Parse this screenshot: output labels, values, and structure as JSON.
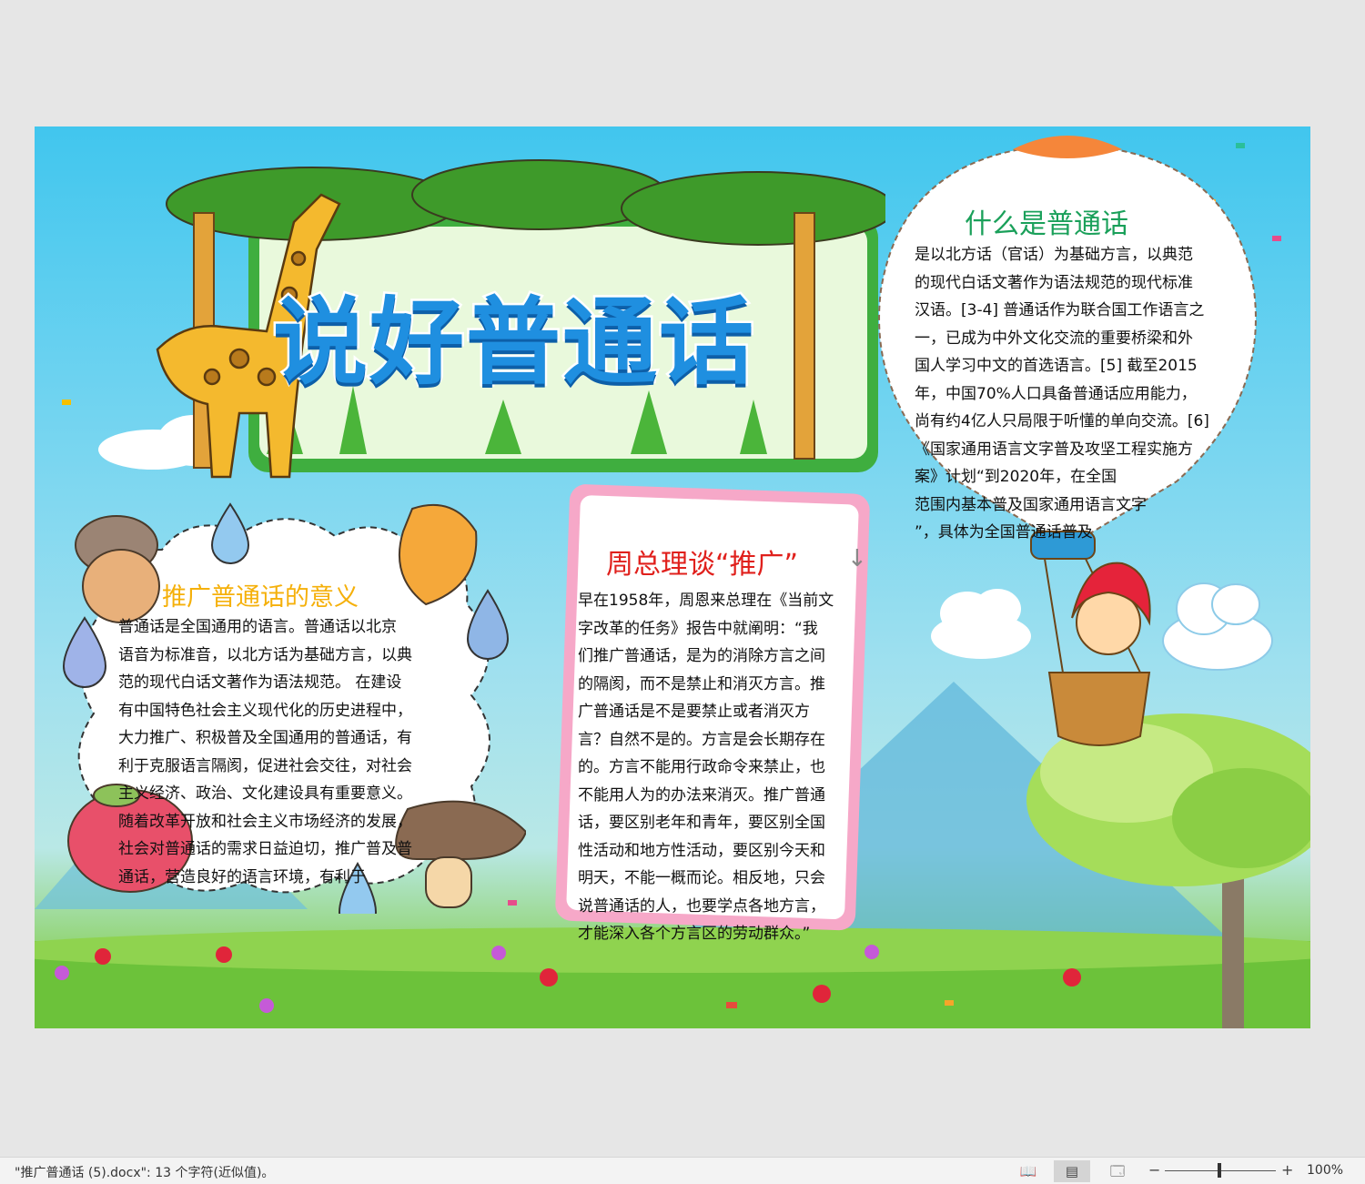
{
  "poster": {
    "title": "说好普通话",
    "section1": {
      "heading": "推广普通话的意义",
      "lines": [
        "普通话是全国通用的语言。普通话以北京",
        "语音为标准音，以北方话为基础方言，以典",
        "范的现代白话文著作为语法规范。 在建设",
        "有中国特色社会主义现代化的历史进程中，",
        "大力推广、积极普及全国通用的普通话，有",
        "利于克服语言隔阂，促进社会交往，对社会",
        "主义经济、政治、文化建设具有重要意义。",
        "随着改革开放和社会主义市场经济的发展，",
        "社会对普通话的需求日益迫切，推广普及普",
        "通话，营造良好的语言环境，有利于"
      ]
    },
    "section2": {
      "heading": "周总理谈“推广”",
      "lines": [
        "早在1958年，周恩来总理在《当前文",
        "字改革的任务》报告中就阐明：“我",
        "们推广普通话，是为的消除方言之间",
        "的隔阂，而不是禁止和消灭方言。推",
        "广普通话是不是要禁止或者消灭方",
        "言？自然不是的。方言是会长期存在",
        "的。方言不能用行政命令来禁止，也",
        "不能用人为的办法来消灭。推广普通",
        "话，要区别老年和青年，要区别全国",
        "性活动和地方性活动，要区别今天和",
        "明天，不能一概而论。相反地，只会",
        "说普通话的人，也要学点各地方言，",
        "才能深入各个方言区的劳动群众。”"
      ]
    },
    "section3": {
      "heading": "什么是普通话",
      "lines": [
        "是以北方话（官话）为基础方言，以典范",
        "的现代白话文著作为语法规范的现代标准",
        "汉语。[3-4]  普通话作为联合国工作语言之",
        "一，已成为中外文化交流的重要桥梁和外",
        "国人学习中文的首选语言。[5]  截至2015",
        "年，中国70%人口具备普通话应用能力，",
        "尚有约4亿人只局限于听懂的单向交流。[6]",
        "《国家通用语言文字普及攻坚工程实施方",
        "案》计划“到2020年，在全国",
        "范围内基本普及国家通用语言文字",
        "”，具体为全国普通话普及"
      ]
    }
  },
  "status_bar": {
    "doc_info": "\"推广普通话 (5).docx\": 13 个字符(近似值)。",
    "zoom_minus": "−",
    "zoom_plus": "+",
    "zoom_level": "100%",
    "view_read_icon": "📖",
    "view_print_icon": "▤",
    "view_web_icon": "🗔"
  },
  "colors": {
    "title_blue": "#1f8fe0",
    "heading1": "#f5b00a",
    "heading2": "#e0201c",
    "heading3": "#1aa05a",
    "sky": "#41c6ee",
    "grass": "#6cc23a"
  }
}
